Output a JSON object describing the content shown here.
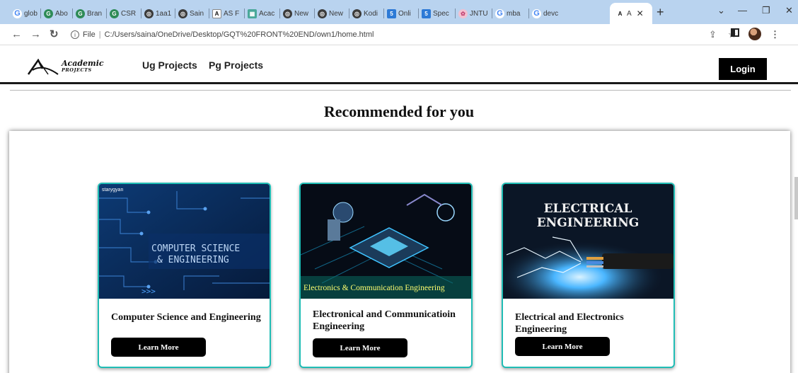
{
  "browser": {
    "tabs": [
      {
        "label": "glob",
        "icon": "google-icon"
      },
      {
        "label": "Abo",
        "icon": "google-icon"
      },
      {
        "label": "Bran",
        "icon": "google-icon"
      },
      {
        "label": "CSR",
        "icon": "google-icon"
      },
      {
        "label": "1aa1",
        "icon": "chrome-icon"
      },
      {
        "label": "Sain",
        "icon": "chrome-icon"
      },
      {
        "label": "AS F",
        "icon": "academic-icon"
      },
      {
        "label": "Acac",
        "icon": "academic-icon"
      },
      {
        "label": "New",
        "icon": "chrome-icon"
      },
      {
        "label": "New",
        "icon": "chrome-icon"
      },
      {
        "label": "Kodi",
        "icon": "chrome-icon"
      },
      {
        "label": "Onli",
        "icon": "book-icon"
      },
      {
        "label": "Spec",
        "icon": "book-icon"
      },
      {
        "label": "JNTU",
        "icon": "university-icon"
      },
      {
        "label": "mba",
        "icon": "google-icon"
      },
      {
        "label": "devc",
        "icon": "google-icon"
      },
      {
        "label": "A",
        "icon": "academic-icon"
      }
    ],
    "url_prefix": "File",
    "url": "C:/Users/saina/OneDrive/Desktop/GQT%20FRONT%20END/own1/home.html"
  },
  "site": {
    "logo_line1": "Academic",
    "logo_line2": "PROJECTS",
    "nav": [
      "Ug Projects",
      "Pg Projects"
    ],
    "login_label": "Login"
  },
  "main": {
    "title": "Recommended for you",
    "cards": [
      {
        "image_text": "COMPUTER SCIENCE & ENGINEERING",
        "image_brand": "starygyan",
        "title": "Computer Science and Engineering",
        "button": "Learn More"
      },
      {
        "image_text": "Electronics & Communication Engineering",
        "title": "Electronical and Communicatioin Engineering",
        "button": "Learn More"
      },
      {
        "image_text": "ELECTRICAL ENGINEERING",
        "title": "Electrical and Electronics Engineering",
        "button": "Learn More"
      }
    ]
  },
  "colors": {
    "accent_border": "#20bdb5",
    "tabstrip": "#b9d3ef",
    "button": "#000000"
  }
}
